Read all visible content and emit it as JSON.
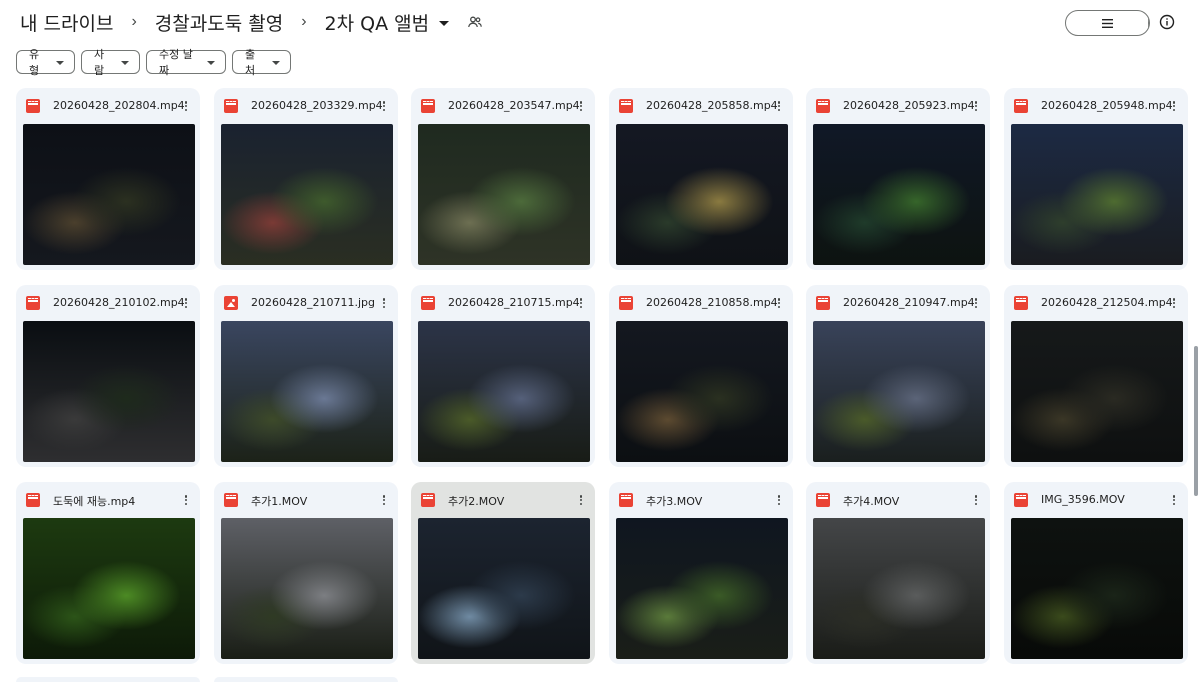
{
  "breadcrumb": {
    "root": "내 드라이브",
    "parent": "경찰과도둑 촬영",
    "current": "2차 QA 앨범",
    "separator": "›"
  },
  "view": {
    "mode": "grid",
    "accent": "#c2e7ff"
  },
  "filters": [
    "유형",
    "사람",
    "수정 날짜",
    "출처"
  ],
  "files": [
    {
      "name": "20260428_202804.mp4",
      "type": "video",
      "thumb": [
        "#0d1016",
        "#2b3020",
        "#4a3f2c",
        "#15181e"
      ]
    },
    {
      "name": "20260428_203329.mp4",
      "type": "video",
      "thumb": [
        "#1a2230",
        "#3e5a2c",
        "#7a3a35",
        "#2a2e22"
      ]
    },
    {
      "name": "20260428_203547.mp4",
      "type": "video",
      "thumb": [
        "#1f2a20",
        "#4c6a3a",
        "#6d6f52",
        "#2e3326"
      ]
    },
    {
      "name": "20260428_205858.mp4",
      "type": "video",
      "thumb": [
        "#141823",
        "#8a7a40",
        "#2a3a2a",
        "#0f1216"
      ]
    },
    {
      "name": "20260428_205923.mp4",
      "type": "video",
      "thumb": [
        "#101827",
        "#36652a",
        "#1f3b2a",
        "#0d1310"
      ]
    },
    {
      "name": "20260428_205948.mp4",
      "type": "video",
      "thumb": [
        "#1c2a44",
        "#4e6b30",
        "#2e3e2c",
        "#1a1c20"
      ]
    },
    {
      "name": "20260428_210102.mp4",
      "type": "video",
      "thumb": [
        "#0a0e12",
        "#1e2a1c",
        "#3a3a3a",
        "#2e2e30"
      ]
    },
    {
      "name": "20260428_210711.jpg",
      "type": "image",
      "thumb": [
        "#3a4660",
        "#6a7894",
        "#3d4a2a",
        "#1c2218"
      ]
    },
    {
      "name": "20260428_210715.mp4",
      "type": "video",
      "thumb": [
        "#2c3448",
        "#55607a",
        "#4a5a28",
        "#181c16"
      ]
    },
    {
      "name": "20260428_210858.mp4",
      "type": "video",
      "thumb": [
        "#141820",
        "#2a3020",
        "#5c4a30",
        "#0c0f12"
      ]
    },
    {
      "name": "20260428_210947.mp4",
      "type": "video",
      "thumb": [
        "#39435a",
        "#5b6478",
        "#4a5a2a",
        "#1a1f1e"
      ]
    },
    {
      "name": "20260428_212504.mp4",
      "type": "video",
      "thumb": [
        "#16191a",
        "#2a2a22",
        "#3a3626",
        "#0e1010"
      ]
    },
    {
      "name": "도둑에 재능.mp4",
      "type": "video",
      "thumb": [
        "#1d3a10",
        "#4c8a24",
        "#2c5418",
        "#0d1a08"
      ]
    },
    {
      "name": "추가1.MOV",
      "type": "video",
      "thumb": [
        "#5e6066",
        "#7c7e82",
        "#2f3a24",
        "#1a1e16"
      ]
    },
    {
      "name": "추가2.MOV",
      "type": "video",
      "thumb": [
        "#1c2430",
        "#2c3a4a",
        "#6f8aa2",
        "#101418"
      ]
    },
    {
      "name": "추가3.MOV",
      "type": "video",
      "thumb": [
        "#0f1620",
        "#3a5a26",
        "#5a7a3a",
        "#1a1e18"
      ]
    },
    {
      "name": "추가4.MOV",
      "type": "video",
      "thumb": [
        "#444648",
        "#5a5c5c",
        "#2c2e26",
        "#1a1c18"
      ]
    },
    {
      "name": "IMG_3596.MOV",
      "type": "video",
      "thumb": [
        "#0e1210",
        "#1a2418",
        "#3a4a1c",
        "#080a08"
      ]
    }
  ],
  "selected_index": 14,
  "icons": {
    "list_view": "list-view-icon",
    "grid_view": "grid-view-icon",
    "info": "info-icon",
    "share": "people-icon",
    "more": "more-vert-icon"
  }
}
